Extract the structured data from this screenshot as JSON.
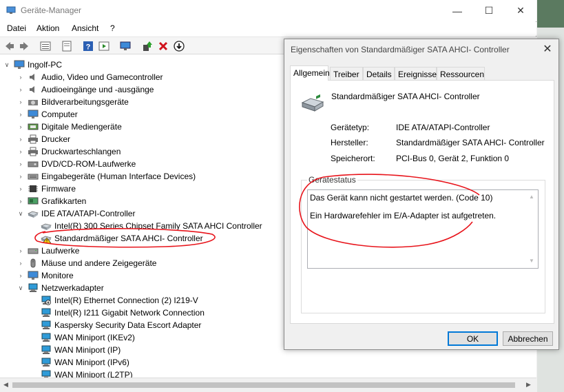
{
  "window": {
    "title": "Geräte-Manager",
    "controls": {
      "minimize": "—",
      "maximize": "☐",
      "close": "✕"
    }
  },
  "menu": [
    "Datei",
    "Aktion",
    "Ansicht",
    "?"
  ],
  "toolbar_icons": [
    "back-icon",
    "forward-icon",
    "properties-view-icon",
    "show-hidden-icon",
    "help-icon",
    "run-icon",
    "monitor-scan-icon",
    "update-driver-icon",
    "uninstall-icon",
    "disable-icon"
  ],
  "tree": {
    "root": "Ingolf-PC",
    "items": [
      {
        "label": "Audio, Video und Gamecontroller",
        "icon": "speaker-icon",
        "expanded": false
      },
      {
        "label": "Audioeingänge und -ausgänge",
        "icon": "speaker-icon",
        "expanded": false
      },
      {
        "label": "Bildverarbeitungsgeräte",
        "icon": "camera-icon",
        "expanded": false
      },
      {
        "label": "Computer",
        "icon": "computer-icon",
        "expanded": false
      },
      {
        "label": "Digitale Mediengeräte",
        "icon": "media-device-icon",
        "expanded": false
      },
      {
        "label": "Drucker",
        "icon": "printer-icon",
        "expanded": false
      },
      {
        "label": "Druckwarteschlangen",
        "icon": "printer-icon",
        "expanded": false
      },
      {
        "label": "DVD/CD-ROM-Laufwerke",
        "icon": "disc-drive-icon",
        "expanded": false
      },
      {
        "label": "Eingabegeräte (Human Interface Devices)",
        "icon": "hid-icon",
        "expanded": false
      },
      {
        "label": "Firmware",
        "icon": "firmware-icon",
        "expanded": false
      },
      {
        "label": "Grafikkarten",
        "icon": "display-adapter-icon",
        "expanded": false
      },
      {
        "label": "IDE ATA/ATAPI-Controller",
        "icon": "controller-icon",
        "expanded": true,
        "children": [
          {
            "label": "Intel(R) 300 Series Chipset Family SATA AHCI Controller",
            "icon": "controller-icon",
            "warning": false
          },
          {
            "label": "Standardmäßiger SATA AHCI- Controller",
            "icon": "controller-icon",
            "warning": true
          }
        ]
      },
      {
        "label": "Laufwerke",
        "icon": "drive-icon",
        "expanded": false
      },
      {
        "label": "Mäuse und andere Zeigegeräte",
        "icon": "mouse-icon",
        "expanded": false
      },
      {
        "label": "Monitore",
        "icon": "monitor-icon",
        "expanded": false
      },
      {
        "label": "Netzwerkadapter",
        "icon": "network-icon",
        "expanded": true,
        "children": [
          {
            "label": "Intel(R) Ethernet Connection (2) I219-V",
            "icon": "network-icon",
            "disabled": true
          },
          {
            "label": "Intel(R) I211 Gigabit Network Connection",
            "icon": "network-icon"
          },
          {
            "label": "Kaspersky Security Data Escort Adapter",
            "icon": "network-icon"
          },
          {
            "label": "WAN Miniport (IKEv2)",
            "icon": "network-icon"
          },
          {
            "label": "WAN Miniport (IP)",
            "icon": "network-icon"
          },
          {
            "label": "WAN Miniport (IPv6)",
            "icon": "network-icon"
          },
          {
            "label": "WAN Miniport (L2TP)",
            "icon": "network-icon"
          }
        ]
      }
    ]
  },
  "dialog": {
    "title": "Eigenschaften von Standardmäßiger SATA AHCI- Controller",
    "close": "✕",
    "tabs": [
      "Allgemein",
      "Treiber",
      "Details",
      "Ereignisse",
      "Ressourcen"
    ],
    "active_tab": "Allgemein",
    "device_name": "Standardmäßiger SATA AHCI- Controller",
    "properties": [
      {
        "label": "Gerätetyp:",
        "value": "IDE ATA/ATAPI-Controller"
      },
      {
        "label": "Hersteller:",
        "value": "Standardmäßiger SATA AHCI- Controller"
      },
      {
        "label": "Speicherort:",
        "value": "PCI-Bus 0, Gerät 2, Funktion 0"
      }
    ],
    "status_group_label": "Gerätestatus",
    "status_lines": [
      "Das Gerät kann nicht gestartet werden. (Code 10)",
      "Ein Hardwarefehler im E/A-Adapter ist aufgetreten."
    ],
    "ok_label": "OK",
    "cancel_label": "Abbrechen"
  },
  "colors": {
    "annotation": "#e8141b",
    "warning": "#f2c811",
    "accent": "#0078d7"
  }
}
